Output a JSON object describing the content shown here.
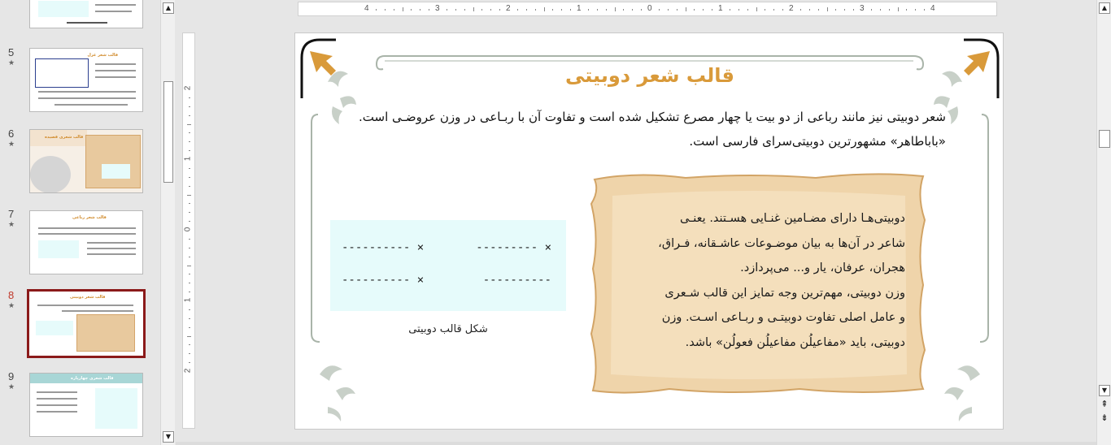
{
  "thumbnails": [
    {
      "number": "",
      "star": "",
      "title": ""
    },
    {
      "number": "5",
      "star": "★",
      "title": "قالب شعر غزل"
    },
    {
      "number": "6",
      "star": "★",
      "title": "قالب شعری قصیده"
    },
    {
      "number": "7",
      "star": "★",
      "title": "قالب شعر رباعی"
    },
    {
      "number": "8",
      "star": "★",
      "title": "قالب شعر دوبیتی"
    },
    {
      "number": "9",
      "star": "★",
      "title": "قالب شعری چهارپاره"
    }
  ],
  "ruler": {
    "horizontal": [
      "4",
      "3",
      "2",
      "1",
      "0",
      "1",
      "2",
      "3",
      "4"
    ],
    "vertical": [
      "2",
      "1",
      "0",
      "1",
      "2"
    ]
  },
  "slide": {
    "title": "قالب شعر دوبیتی",
    "intro": "شعر دوبیتی نیز مانند رباعی از دو بیت یا چهار مصرع تشکیل شده است و تفاوت آن با ربـاعی در وزن عروضـی است. «باباطاهر» مشهورترین دوبیتی‌سرای فارسی است.",
    "scroll_lines": [
      "دوبیتی‌هـا دارای مضـامین غنـایی هسـتند. یعنـی",
      "شاعر در آن‌ها به بیان موضـوعات عاشـقانه، فـراق،",
      "هجران، عرفان، یار و... می‌پردازد.",
      "وزن دوبیتی، مهم‌ترین وجه تمایز این قالب شـعری",
      "و عامل اصلی تفاوت دوبیتـی و ربـاعی اسـت. وزن",
      "دوبیتی، باید «مفاعیلُن مفاعیلُن فعولُن» باشد."
    ],
    "poem": {
      "row1_right": "--------- ×",
      "row1_left": "---------- ×",
      "row2_right": "----------",
      "row2_left": "---------- ×"
    },
    "caption": "شکل قالب دوبیتی"
  },
  "scrollbars": {
    "up": "▲",
    "down": "▼",
    "prev_slide": "⇞",
    "next_slide": "⇟"
  },
  "colors": {
    "accent_orange": "#d99a3a",
    "selection": "#8b1a1a",
    "poem_bg": "#e6fbfb",
    "paper": "#efd4aa",
    "ornament": "#9aa89a"
  }
}
